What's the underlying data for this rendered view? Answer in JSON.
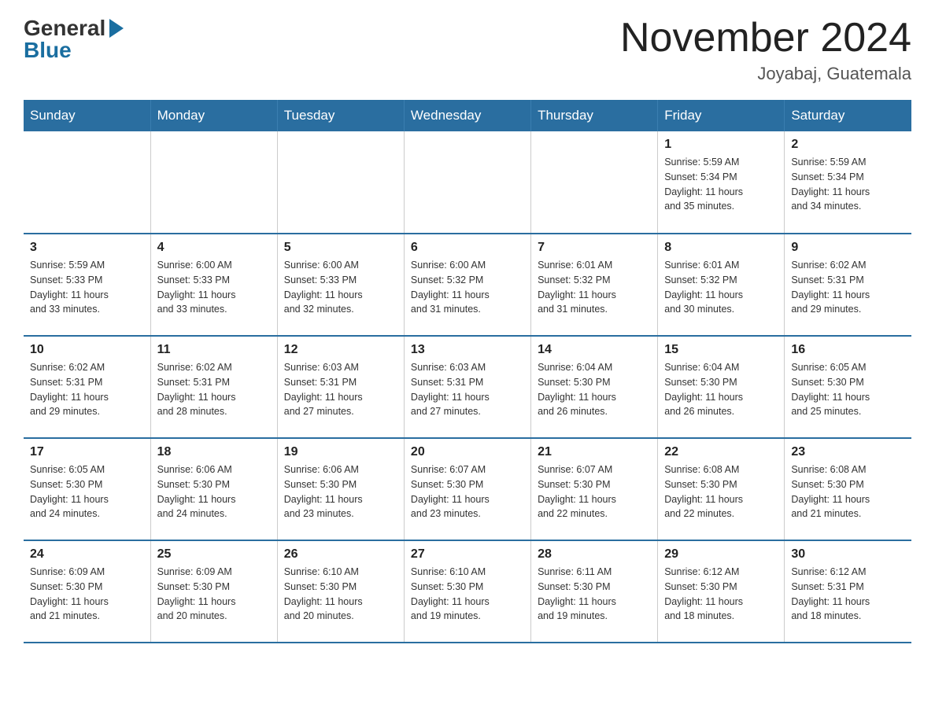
{
  "header": {
    "logo_general": "General",
    "logo_blue": "Blue",
    "title": "November 2024",
    "location": "Joyabaj, Guatemala"
  },
  "weekdays": [
    "Sunday",
    "Monday",
    "Tuesday",
    "Wednesday",
    "Thursday",
    "Friday",
    "Saturday"
  ],
  "weeks": [
    {
      "days": [
        {
          "num": "",
          "info": ""
        },
        {
          "num": "",
          "info": ""
        },
        {
          "num": "",
          "info": ""
        },
        {
          "num": "",
          "info": ""
        },
        {
          "num": "",
          "info": ""
        },
        {
          "num": "1",
          "info": "Sunrise: 5:59 AM\nSunset: 5:34 PM\nDaylight: 11 hours\nand 35 minutes."
        },
        {
          "num": "2",
          "info": "Sunrise: 5:59 AM\nSunset: 5:34 PM\nDaylight: 11 hours\nand 34 minutes."
        }
      ]
    },
    {
      "days": [
        {
          "num": "3",
          "info": "Sunrise: 5:59 AM\nSunset: 5:33 PM\nDaylight: 11 hours\nand 33 minutes."
        },
        {
          "num": "4",
          "info": "Sunrise: 6:00 AM\nSunset: 5:33 PM\nDaylight: 11 hours\nand 33 minutes."
        },
        {
          "num": "5",
          "info": "Sunrise: 6:00 AM\nSunset: 5:33 PM\nDaylight: 11 hours\nand 32 minutes."
        },
        {
          "num": "6",
          "info": "Sunrise: 6:00 AM\nSunset: 5:32 PM\nDaylight: 11 hours\nand 31 minutes."
        },
        {
          "num": "7",
          "info": "Sunrise: 6:01 AM\nSunset: 5:32 PM\nDaylight: 11 hours\nand 31 minutes."
        },
        {
          "num": "8",
          "info": "Sunrise: 6:01 AM\nSunset: 5:32 PM\nDaylight: 11 hours\nand 30 minutes."
        },
        {
          "num": "9",
          "info": "Sunrise: 6:02 AM\nSunset: 5:31 PM\nDaylight: 11 hours\nand 29 minutes."
        }
      ]
    },
    {
      "days": [
        {
          "num": "10",
          "info": "Sunrise: 6:02 AM\nSunset: 5:31 PM\nDaylight: 11 hours\nand 29 minutes."
        },
        {
          "num": "11",
          "info": "Sunrise: 6:02 AM\nSunset: 5:31 PM\nDaylight: 11 hours\nand 28 minutes."
        },
        {
          "num": "12",
          "info": "Sunrise: 6:03 AM\nSunset: 5:31 PM\nDaylight: 11 hours\nand 27 minutes."
        },
        {
          "num": "13",
          "info": "Sunrise: 6:03 AM\nSunset: 5:31 PM\nDaylight: 11 hours\nand 27 minutes."
        },
        {
          "num": "14",
          "info": "Sunrise: 6:04 AM\nSunset: 5:30 PM\nDaylight: 11 hours\nand 26 minutes."
        },
        {
          "num": "15",
          "info": "Sunrise: 6:04 AM\nSunset: 5:30 PM\nDaylight: 11 hours\nand 26 minutes."
        },
        {
          "num": "16",
          "info": "Sunrise: 6:05 AM\nSunset: 5:30 PM\nDaylight: 11 hours\nand 25 minutes."
        }
      ]
    },
    {
      "days": [
        {
          "num": "17",
          "info": "Sunrise: 6:05 AM\nSunset: 5:30 PM\nDaylight: 11 hours\nand 24 minutes."
        },
        {
          "num": "18",
          "info": "Sunrise: 6:06 AM\nSunset: 5:30 PM\nDaylight: 11 hours\nand 24 minutes."
        },
        {
          "num": "19",
          "info": "Sunrise: 6:06 AM\nSunset: 5:30 PM\nDaylight: 11 hours\nand 23 minutes."
        },
        {
          "num": "20",
          "info": "Sunrise: 6:07 AM\nSunset: 5:30 PM\nDaylight: 11 hours\nand 23 minutes."
        },
        {
          "num": "21",
          "info": "Sunrise: 6:07 AM\nSunset: 5:30 PM\nDaylight: 11 hours\nand 22 minutes."
        },
        {
          "num": "22",
          "info": "Sunrise: 6:08 AM\nSunset: 5:30 PM\nDaylight: 11 hours\nand 22 minutes."
        },
        {
          "num": "23",
          "info": "Sunrise: 6:08 AM\nSunset: 5:30 PM\nDaylight: 11 hours\nand 21 minutes."
        }
      ]
    },
    {
      "days": [
        {
          "num": "24",
          "info": "Sunrise: 6:09 AM\nSunset: 5:30 PM\nDaylight: 11 hours\nand 21 minutes."
        },
        {
          "num": "25",
          "info": "Sunrise: 6:09 AM\nSunset: 5:30 PM\nDaylight: 11 hours\nand 20 minutes."
        },
        {
          "num": "26",
          "info": "Sunrise: 6:10 AM\nSunset: 5:30 PM\nDaylight: 11 hours\nand 20 minutes."
        },
        {
          "num": "27",
          "info": "Sunrise: 6:10 AM\nSunset: 5:30 PM\nDaylight: 11 hours\nand 19 minutes."
        },
        {
          "num": "28",
          "info": "Sunrise: 6:11 AM\nSunset: 5:30 PM\nDaylight: 11 hours\nand 19 minutes."
        },
        {
          "num": "29",
          "info": "Sunrise: 6:12 AM\nSunset: 5:30 PM\nDaylight: 11 hours\nand 18 minutes."
        },
        {
          "num": "30",
          "info": "Sunrise: 6:12 AM\nSunset: 5:31 PM\nDaylight: 11 hours\nand 18 minutes."
        }
      ]
    }
  ]
}
